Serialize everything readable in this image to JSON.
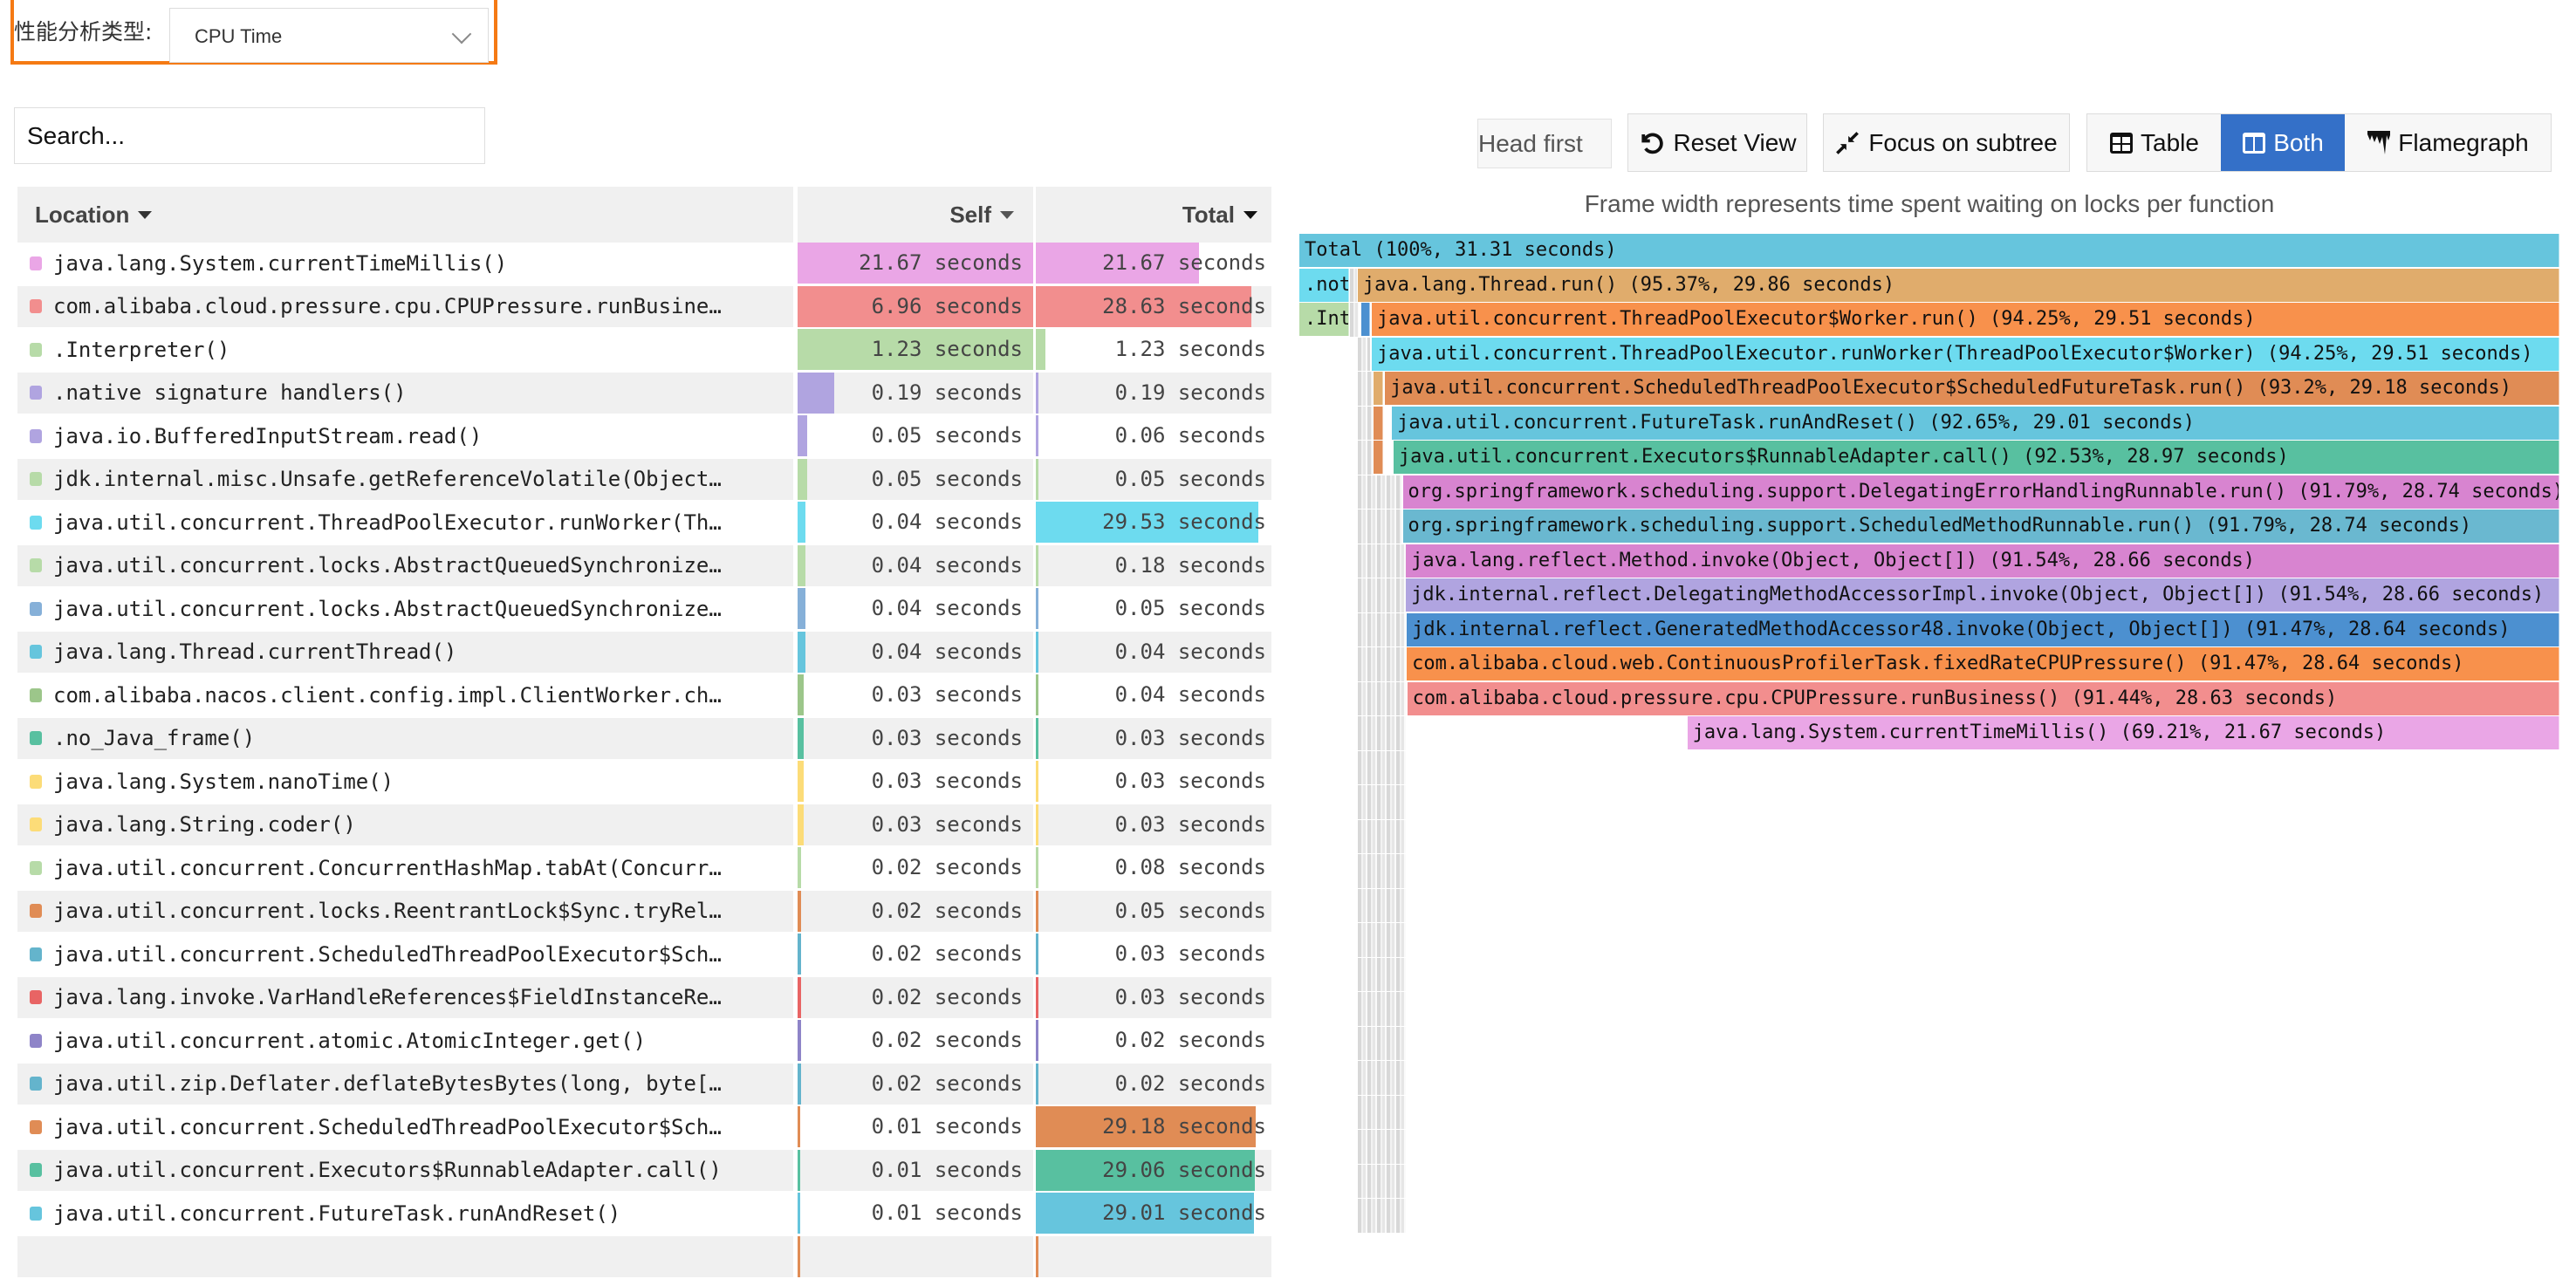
{
  "analysis_type": {
    "label": "性能分析类型:",
    "selected": "CPU Time"
  },
  "search": {
    "placeholder": "Search..."
  },
  "toolbar": {
    "head_first": "Head first",
    "reset_view": "Reset View",
    "focus_subtree": "Focus on subtree",
    "views": [
      {
        "label": "Table",
        "active": false,
        "icon": "table-icon"
      },
      {
        "label": "Both",
        "active": true,
        "icon": "columns-icon"
      },
      {
        "label": "Flamegraph",
        "active": false,
        "icon": "flamegraph-icon"
      }
    ]
  },
  "colors": {
    "accent": "#3470c8",
    "highlight_border": "#f57a14"
  },
  "table": {
    "headers": {
      "location": "Location",
      "self": "Self",
      "total": "Total"
    },
    "total_seconds": 31.31,
    "rows": [
      {
        "location": "java.lang.System.currentTimeMillis()",
        "color": "#eaa6e6",
        "self": 21.67,
        "self_label": "21.67 seconds",
        "total": 21.67,
        "total_label": "21.67 seconds"
      },
      {
        "location": "com.alibaba.cloud.pressure.cpu.CPUPressure.runBusine…",
        "color": "#f28e8e",
        "self": 6.96,
        "self_label": "6.96 seconds",
        "total": 28.63,
        "total_label": "28.63 seconds"
      },
      {
        "location": ".Interpreter()",
        "color": "#b7dba8",
        "self": 1.23,
        "self_label": "1.23 seconds",
        "total": 1.23,
        "total_label": "1.23 seconds"
      },
      {
        "location": ".native signature handlers()",
        "color": "#b0a4e0",
        "self": 0.19,
        "self_label": "0.19 seconds",
        "total": 0.19,
        "total_label": "0.19 seconds"
      },
      {
        "location": "java.io.BufferedInputStream.read()",
        "color": "#b0a4e0",
        "self": 0.05,
        "self_label": "0.05 seconds",
        "total": 0.06,
        "total_label": "0.06 seconds"
      },
      {
        "location": "jdk.internal.misc.Unsafe.getReferenceVolatile(Object…",
        "color": "#b7dba8",
        "self": 0.05,
        "self_label": "0.05 seconds",
        "total": 0.05,
        "total_label": "0.05 seconds"
      },
      {
        "location": "java.util.concurrent.ThreadPoolExecutor.runWorker(Th…",
        "color": "#6ddbef",
        "self": 0.04,
        "self_label": "0.04 seconds",
        "total": 29.53,
        "total_label": "29.53 seconds"
      },
      {
        "location": "java.util.concurrent.locks.AbstractQueuedSynchronize…",
        "color": "#b7dba8",
        "self": 0.04,
        "self_label": "0.04 seconds",
        "total": 0.18,
        "total_label": "0.18 seconds"
      },
      {
        "location": "java.util.concurrent.locks.AbstractQueuedSynchronize…",
        "color": "#86b0d8",
        "self": 0.04,
        "self_label": "0.04 seconds",
        "total": 0.05,
        "total_label": "0.05 seconds"
      },
      {
        "location": "java.lang.Thread.currentThread()",
        "color": "#66c5dd",
        "self": 0.04,
        "self_label": "0.04 seconds",
        "total": 0.04,
        "total_label": "0.04 seconds"
      },
      {
        "location": "com.alibaba.nacos.client.config.impl.ClientWorker.ch…",
        "color": "#9cc68a",
        "self": 0.03,
        "self_label": "0.03 seconds",
        "total": 0.04,
        "total_label": "0.04 seconds"
      },
      {
        "location": ".no_Java_frame()",
        "color": "#58c0a0",
        "self": 0.03,
        "self_label": "0.03 seconds",
        "total": 0.03,
        "total_label": "0.03 seconds"
      },
      {
        "location": "java.lang.System.nanoTime()",
        "color": "#fcdc78",
        "self": 0.03,
        "self_label": "0.03 seconds",
        "total": 0.03,
        "total_label": "0.03 seconds"
      },
      {
        "location": "java.lang.String.coder()",
        "color": "#fcdc78",
        "self": 0.03,
        "self_label": "0.03 seconds",
        "total": 0.03,
        "total_label": "0.03 seconds"
      },
      {
        "location": "java.util.concurrent.ConcurrentHashMap.tabAt(Concurr…",
        "color": "#b7dba8",
        "self": 0.02,
        "self_label": "0.02 seconds",
        "total": 0.08,
        "total_label": "0.08 seconds"
      },
      {
        "location": "java.util.concurrent.locks.ReentrantLock$Sync.tryRel…",
        "color": "#e08c55",
        "self": 0.02,
        "self_label": "0.02 seconds",
        "total": 0.05,
        "total_label": "0.05 seconds"
      },
      {
        "location": "java.util.concurrent.ScheduledThreadPoolExecutor$Sch…",
        "color": "#64b4cc",
        "self": 0.02,
        "self_label": "0.02 seconds",
        "total": 0.03,
        "total_label": "0.03 seconds"
      },
      {
        "location": "java.lang.invoke.VarHandleReferences$FieldInstanceRe…",
        "color": "#e86464",
        "self": 0.02,
        "self_label": "0.02 seconds",
        "total": 0.03,
        "total_label": "0.03 seconds"
      },
      {
        "location": "java.util.concurrent.atomic.AtomicInteger.get()",
        "color": "#8e84c8",
        "self": 0.02,
        "self_label": "0.02 seconds",
        "total": 0.02,
        "total_label": "0.02 seconds"
      },
      {
        "location": "java.util.zip.Deflater.deflateBytesBytes(long, byte[…",
        "color": "#64b4cc",
        "self": 0.02,
        "self_label": "0.02 seconds",
        "total": 0.02,
        "total_label": "0.02 seconds"
      },
      {
        "location": "java.util.concurrent.ScheduledThreadPoolExecutor$Sch…",
        "color": "#e08c55",
        "self": 0.01,
        "self_label": "0.01 seconds",
        "total": 29.18,
        "total_label": "29.18 seconds"
      },
      {
        "location": "java.util.concurrent.Executors$RunnableAdapter.call()",
        "color": "#58c0a0",
        "self": 0.01,
        "self_label": "0.01 seconds",
        "total": 29.06,
        "total_label": "29.06 seconds"
      },
      {
        "location": "java.util.concurrent.FutureTask.runAndReset()",
        "color": "#66c5dd",
        "self": 0.01,
        "self_label": "0.01 seconds",
        "total": 29.01,
        "total_label": "29.01 seconds"
      },
      {
        "location": "",
        "color": "#e08c55",
        "self": 0.01,
        "self_label": "",
        "total": 0.05,
        "total_label": ""
      }
    ]
  },
  "flamegraph": {
    "title": "Frame width represents time spent waiting on locks per function",
    "total_seconds": 31.31,
    "frames": [
      {
        "depth": 0,
        "start_pct": 0,
        "pct": 100,
        "label": "Total (100%, 31.31 seconds)",
        "color": "#66c5dd"
      },
      {
        "depth": 1,
        "start_pct": 0,
        "pct": 3.95,
        "label": ".not",
        "color": "#6ddbef"
      },
      {
        "depth": 1,
        "start_pct": 4.63,
        "pct": 95.37,
        "label": "java.lang.Thread.run() (95.37%, 29.86 seconds)",
        "color": "#e0ac6c"
      },
      {
        "depth": 2,
        "start_pct": 0,
        "pct": 3.95,
        "label": ".Int",
        "color": "#b7dba8"
      },
      {
        "depth": 2,
        "start_pct": 4.92,
        "pct": 0.7,
        "label": "",
        "color": "#4c90d0"
      },
      {
        "depth": 2,
        "start_pct": 5.75,
        "pct": 94.25,
        "label": "java.util.concurrent.ThreadPoolExecutor$Worker.run() (94.25%, 29.51 seconds)",
        "color": "#f8914c"
      },
      {
        "depth": 3,
        "start_pct": 5.75,
        "pct": 94.25,
        "label": "java.util.concurrent.ThreadPoolExecutor.runWorker(ThreadPoolExecutor$Worker) (94.25%, 29.51 seconds)",
        "color": "#6ddbef"
      },
      {
        "depth": 4,
        "start_pct": 5.9,
        "pct": 0.75,
        "label": "",
        "color": "#e0ac6c"
      },
      {
        "depth": 4,
        "start_pct": 6.8,
        "pct": 93.2,
        "label": "java.util.concurrent.ScheduledThreadPoolExecutor$ScheduledFutureTask.run() (93.2%, 29.18 seconds)",
        "color": "#e08c55"
      },
      {
        "depth": 5,
        "start_pct": 5.9,
        "pct": 0.75,
        "label": "",
        "color": "#e08c55"
      },
      {
        "depth": 5,
        "start_pct": 7.35,
        "pct": 92.65,
        "label": "java.util.concurrent.FutureTask.runAndReset() (92.65%, 29.01 seconds)",
        "color": "#66c5dd"
      },
      {
        "depth": 6,
        "start_pct": 5.9,
        "pct": 0.75,
        "label": "",
        "color": "#e08c55"
      },
      {
        "depth": 6,
        "start_pct": 7.47,
        "pct": 92.53,
        "label": "java.util.concurrent.Executors$RunnableAdapter.call() (92.53%, 28.97 seconds)",
        "color": "#58c0a0"
      },
      {
        "depth": 7,
        "start_pct": 8.21,
        "pct": 91.79,
        "label": "org.springframework.scheduling.support.DelegatingErrorHandlingRunnable.run() (91.79%, 28.74 seconds)",
        "color": "#d884d0"
      },
      {
        "depth": 8,
        "start_pct": 8.21,
        "pct": 91.79,
        "label": "org.springframework.scheduling.support.ScheduledMethodRunnable.run() (91.79%, 28.74 seconds)",
        "color": "#6ab8d0"
      },
      {
        "depth": 9,
        "start_pct": 8.46,
        "pct": 91.54,
        "label": "java.lang.reflect.Method.invoke(Object, Object[]) (91.54%, 28.66 seconds)",
        "color": "#d884d0"
      },
      {
        "depth": 10,
        "start_pct": 8.46,
        "pct": 91.54,
        "label": "jdk.internal.reflect.DelegatingMethodAccessorImpl.invoke(Object, Object[]) (91.54%, 28.66 seconds)",
        "color": "#b0a4e0"
      },
      {
        "depth": 11,
        "start_pct": 8.53,
        "pct": 91.47,
        "label": "jdk.internal.reflect.GeneratedMethodAccessor48.invoke(Object, Object[]) (91.47%, 28.64 seconds)",
        "color": "#4c90d0"
      },
      {
        "depth": 12,
        "start_pct": 8.53,
        "pct": 91.47,
        "label": "com.alibaba.cloud.web.ContinuousProfilerTask.fixedRateCPUPressure() (91.47%, 28.64 seconds)",
        "color": "#f8914c"
      },
      {
        "depth": 13,
        "start_pct": 8.56,
        "pct": 91.44,
        "label": "com.alibaba.cloud.pressure.cpu.CPUPressure.runBusiness() (91.44%, 28.63 seconds)",
        "color": "#f28e8e"
      },
      {
        "depth": 14,
        "start_pct": 30.79,
        "pct": 69.21,
        "label": "java.lang.System.currentTimeMillis() (69.21%, 21.67 seconds)",
        "color": "#eaa6e6"
      }
    ]
  }
}
